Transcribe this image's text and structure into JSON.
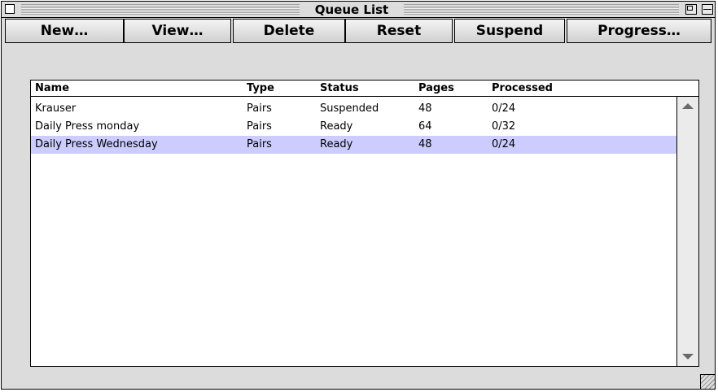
{
  "window": {
    "title": "Queue List"
  },
  "toolbar": {
    "buttons": [
      "New…",
      "View…",
      "Delete",
      "Reset",
      "Suspend",
      "Progress…"
    ]
  },
  "table": {
    "columns": [
      "Name",
      "Type",
      "Status",
      "Pages",
      "Processed"
    ],
    "rows": [
      {
        "name": "Krauser",
        "type": "Pairs",
        "status": "Suspended",
        "pages": "48",
        "processed": "0/24",
        "selected": false
      },
      {
        "name": "Daily Press monday",
        "type": "Pairs",
        "status": "Ready",
        "pages": "64",
        "processed": "0/32",
        "selected": false
      },
      {
        "name": "Daily Press Wednesday",
        "type": "Pairs",
        "status": "Ready",
        "pages": "48",
        "processed": "0/24",
        "selected": true
      }
    ]
  },
  "colors": {
    "selection": "#ccccff",
    "window_bg": "#dcdcdc"
  },
  "icons": [
    "close-box-icon",
    "zoom-box-icon",
    "collapse-box-icon",
    "scroll-up-arrow-icon",
    "scroll-down-arrow-icon",
    "grow-box-icon"
  ]
}
